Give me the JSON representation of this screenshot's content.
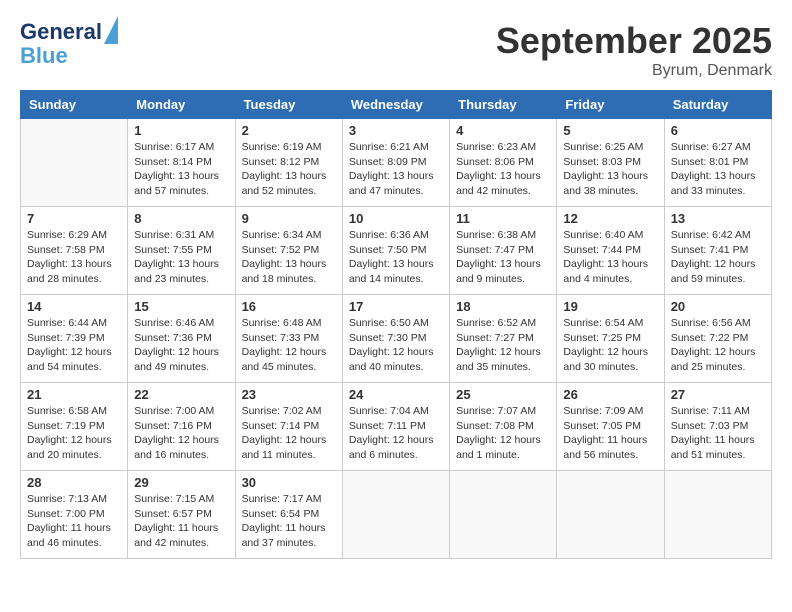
{
  "logo": {
    "line1": "General",
    "line2": "Blue"
  },
  "title": "September 2025",
  "location": "Byrum, Denmark",
  "days_of_week": [
    "Sunday",
    "Monday",
    "Tuesday",
    "Wednesday",
    "Thursday",
    "Friday",
    "Saturday"
  ],
  "weeks": [
    [
      {
        "num": "",
        "info": ""
      },
      {
        "num": "1",
        "info": "Sunrise: 6:17 AM\nSunset: 8:14 PM\nDaylight: 13 hours\nand 57 minutes."
      },
      {
        "num": "2",
        "info": "Sunrise: 6:19 AM\nSunset: 8:12 PM\nDaylight: 13 hours\nand 52 minutes."
      },
      {
        "num": "3",
        "info": "Sunrise: 6:21 AM\nSunset: 8:09 PM\nDaylight: 13 hours\nand 47 minutes."
      },
      {
        "num": "4",
        "info": "Sunrise: 6:23 AM\nSunset: 8:06 PM\nDaylight: 13 hours\nand 42 minutes."
      },
      {
        "num": "5",
        "info": "Sunrise: 6:25 AM\nSunset: 8:03 PM\nDaylight: 13 hours\nand 38 minutes."
      },
      {
        "num": "6",
        "info": "Sunrise: 6:27 AM\nSunset: 8:01 PM\nDaylight: 13 hours\nand 33 minutes."
      }
    ],
    [
      {
        "num": "7",
        "info": "Sunrise: 6:29 AM\nSunset: 7:58 PM\nDaylight: 13 hours\nand 28 minutes."
      },
      {
        "num": "8",
        "info": "Sunrise: 6:31 AM\nSunset: 7:55 PM\nDaylight: 13 hours\nand 23 minutes."
      },
      {
        "num": "9",
        "info": "Sunrise: 6:34 AM\nSunset: 7:52 PM\nDaylight: 13 hours\nand 18 minutes."
      },
      {
        "num": "10",
        "info": "Sunrise: 6:36 AM\nSunset: 7:50 PM\nDaylight: 13 hours\nand 14 minutes."
      },
      {
        "num": "11",
        "info": "Sunrise: 6:38 AM\nSunset: 7:47 PM\nDaylight: 13 hours\nand 9 minutes."
      },
      {
        "num": "12",
        "info": "Sunrise: 6:40 AM\nSunset: 7:44 PM\nDaylight: 13 hours\nand 4 minutes."
      },
      {
        "num": "13",
        "info": "Sunrise: 6:42 AM\nSunset: 7:41 PM\nDaylight: 12 hours\nand 59 minutes."
      }
    ],
    [
      {
        "num": "14",
        "info": "Sunrise: 6:44 AM\nSunset: 7:39 PM\nDaylight: 12 hours\nand 54 minutes."
      },
      {
        "num": "15",
        "info": "Sunrise: 6:46 AM\nSunset: 7:36 PM\nDaylight: 12 hours\nand 49 minutes."
      },
      {
        "num": "16",
        "info": "Sunrise: 6:48 AM\nSunset: 7:33 PM\nDaylight: 12 hours\nand 45 minutes."
      },
      {
        "num": "17",
        "info": "Sunrise: 6:50 AM\nSunset: 7:30 PM\nDaylight: 12 hours\nand 40 minutes."
      },
      {
        "num": "18",
        "info": "Sunrise: 6:52 AM\nSunset: 7:27 PM\nDaylight: 12 hours\nand 35 minutes."
      },
      {
        "num": "19",
        "info": "Sunrise: 6:54 AM\nSunset: 7:25 PM\nDaylight: 12 hours\nand 30 minutes."
      },
      {
        "num": "20",
        "info": "Sunrise: 6:56 AM\nSunset: 7:22 PM\nDaylight: 12 hours\nand 25 minutes."
      }
    ],
    [
      {
        "num": "21",
        "info": "Sunrise: 6:58 AM\nSunset: 7:19 PM\nDaylight: 12 hours\nand 20 minutes."
      },
      {
        "num": "22",
        "info": "Sunrise: 7:00 AM\nSunset: 7:16 PM\nDaylight: 12 hours\nand 16 minutes."
      },
      {
        "num": "23",
        "info": "Sunrise: 7:02 AM\nSunset: 7:14 PM\nDaylight: 12 hours\nand 11 minutes."
      },
      {
        "num": "24",
        "info": "Sunrise: 7:04 AM\nSunset: 7:11 PM\nDaylight: 12 hours\nand 6 minutes."
      },
      {
        "num": "25",
        "info": "Sunrise: 7:07 AM\nSunset: 7:08 PM\nDaylight: 12 hours\nand 1 minute."
      },
      {
        "num": "26",
        "info": "Sunrise: 7:09 AM\nSunset: 7:05 PM\nDaylight: 11 hours\nand 56 minutes."
      },
      {
        "num": "27",
        "info": "Sunrise: 7:11 AM\nSunset: 7:03 PM\nDaylight: 11 hours\nand 51 minutes."
      }
    ],
    [
      {
        "num": "28",
        "info": "Sunrise: 7:13 AM\nSunset: 7:00 PM\nDaylight: 11 hours\nand 46 minutes."
      },
      {
        "num": "29",
        "info": "Sunrise: 7:15 AM\nSunset: 6:57 PM\nDaylight: 11 hours\nand 42 minutes."
      },
      {
        "num": "30",
        "info": "Sunrise: 7:17 AM\nSunset: 6:54 PM\nDaylight: 11 hours\nand 37 minutes."
      },
      {
        "num": "",
        "info": ""
      },
      {
        "num": "",
        "info": ""
      },
      {
        "num": "",
        "info": ""
      },
      {
        "num": "",
        "info": ""
      }
    ]
  ]
}
